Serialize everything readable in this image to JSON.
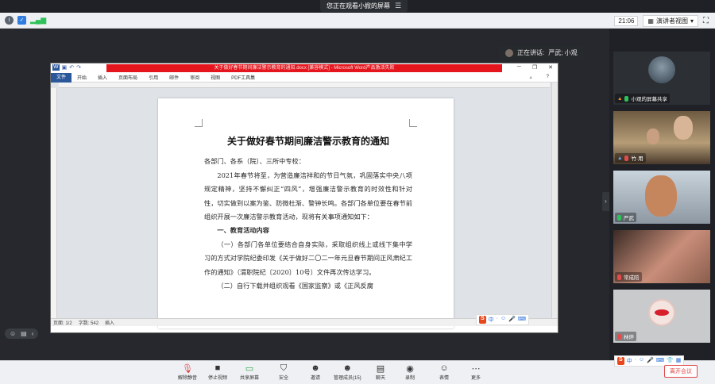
{
  "share_banner": {
    "text": "您正在观看小掀的屏幕",
    "menu_icon": "menu-icon"
  },
  "topbar": {
    "time": "21:06",
    "view_label": "演讲者视图",
    "dropdown_icon": "chevron-down-icon"
  },
  "speaker": {
    "prefix": "正在讲话:",
    "name": "严武; 小观"
  },
  "word": {
    "title": "关于做好春节期间廉洁警示教育的通知.docx [兼容模式] - Microsoft Word产品激活失败",
    "menu": [
      "文件",
      "开始",
      "插入",
      "页面布局",
      "引用",
      "邮件",
      "审阅",
      "视图",
      "PDF工具集"
    ],
    "status_page": "页面: 1/2",
    "status_words": "字数: 542",
    "status_mode": "插入",
    "zoom": "100%",
    "doc": {
      "title": "关于做好春节期间廉洁警示教育的通知",
      "addressee": "各部门、各系（院）、三所中专校：",
      "para1": "2021年春节将至，为营造廉洁祥和的节日气氛，巩固落实中央八项规定精神，坚持不懈纠正“四风”，增强廉洁警示教育的时效性和针对性，切实做到以案为鉴、防微杜渐、警钟长鸣。各部门各单位要在春节前组织开展一次廉洁警示教育活动，现将有关事项通知如下：",
      "section1": "一、教育活动内容",
      "para2": "（一）各部门各单位要结合自身实际，采取组织线上或线下集中学习的方式对学院纪委印发《关于做好二〇二一年元旦春节期间正风肃纪工作的通知》（渭职院纪〔2020〕10号）文件再次传达学习。",
      "para3": "（二）自行下载并组织观看《国家监察》或《正风反腐"
    }
  },
  "ime": {
    "brand": "S",
    "items": [
      "中",
      "·",
      "☺",
      "🎤",
      "⌨",
      "👕",
      "▦"
    ]
  },
  "participants": [
    {
      "name": "小观的屏幕共享",
      "mic": "on"
    },
    {
      "name": "竹·用",
      "mic": "off"
    },
    {
      "name": "严武",
      "mic": "on"
    },
    {
      "name": "常成陪",
      "mic": "off"
    },
    {
      "name": "林烨",
      "mic": "off"
    }
  ],
  "toolbar": [
    {
      "label": "解除静音",
      "icon": "microphone-muted-icon"
    },
    {
      "label": "停止视频",
      "icon": "video-camera-icon"
    },
    {
      "label": "共享屏幕",
      "icon": "screen-share-icon"
    },
    {
      "label": "安全",
      "icon": "shield-icon"
    },
    {
      "label": "邀请",
      "icon": "invite-icon"
    },
    {
      "label": "管理成员(15)",
      "icon": "members-icon"
    },
    {
      "label": "聊天",
      "icon": "chat-icon"
    },
    {
      "label": "录制",
      "icon": "record-icon"
    },
    {
      "label": "表情",
      "icon": "emoji-icon"
    },
    {
      "label": "更多",
      "icon": "more-icon"
    }
  ],
  "leave_label": "离开会议",
  "colors": {
    "word_red": "#e4151d",
    "word_blue": "#2a579a",
    "leave_red": "#e04848"
  }
}
